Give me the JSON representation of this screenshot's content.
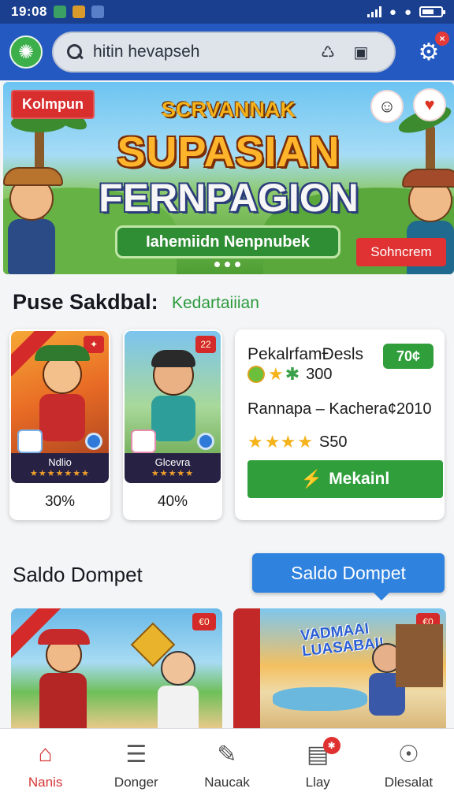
{
  "status_bar": {
    "time": "19:08"
  },
  "header": {
    "search_placeholder": "hitin hevapseh"
  },
  "banner": {
    "tag": "Kolmpun",
    "subtitle": "SCRVANNAK",
    "title_line1": "SUPASIAN",
    "title_line2": "FERNPAGION",
    "cta": "Iahemiidn Nenpnubek",
    "side_button": "Sohncrem"
  },
  "section1": {
    "title": "Puse Sakdbal:",
    "subtitle": "Kedartaiiian",
    "games": [
      {
        "label": "Ndlio",
        "percent": "30%",
        "corner": "✦"
      },
      {
        "label": "Glcevra",
        "percent": "40%",
        "corner": "22"
      }
    ],
    "info": {
      "title": "PekalrfamÐesls",
      "badge": "70¢",
      "row1_value": "300",
      "row2_text": "Rannapa – Kachera¢2010",
      "row3_value": "S50",
      "button": "Mekainl"
    }
  },
  "section2": {
    "title": "Saldo Dompet",
    "button": "Saldo Dompet",
    "promos": [
      {
        "corner": "€0",
        "title": ""
      },
      {
        "corner": "€0",
        "title": "VADMAAI\nLUASABAI!"
      }
    ]
  },
  "bottom_nav": [
    {
      "label": "Nanis",
      "icon": "home-icon"
    },
    {
      "label": "Donger",
      "icon": "menu-icon"
    },
    {
      "label": "Naucak",
      "icon": "tag-icon"
    },
    {
      "label": "Llay",
      "icon": "calendar-icon"
    },
    {
      "label": "Dlesalat",
      "icon": "user-icon"
    }
  ],
  "colors": {
    "header": "#2459c2",
    "accent_green": "#2f9e3b",
    "accent_red": "#d63333",
    "wallet_blue": "#2f82de"
  }
}
